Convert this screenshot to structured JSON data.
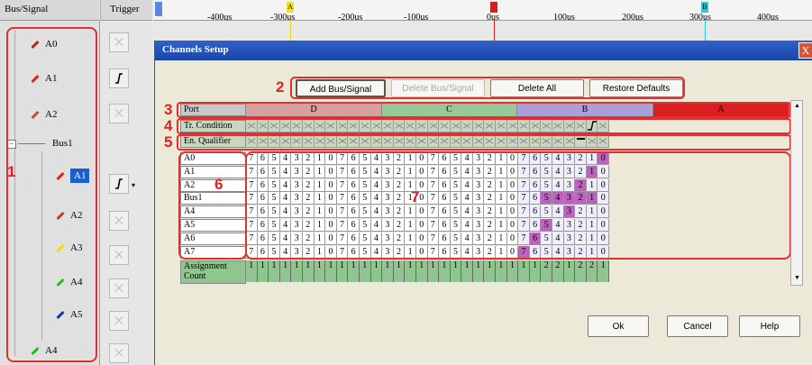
{
  "left_panel": {
    "header": "Bus/Signal",
    "trigger_header": "Trigger",
    "signals": [
      {
        "label": "A0",
        "color": "#b8202a",
        "trigger": "x"
      },
      {
        "label": "A1",
        "color": "#e02020",
        "trigger": "rise"
      },
      {
        "label": "A2",
        "color": "#d04818",
        "trigger": "x"
      },
      {
        "label": "Bus1",
        "color": "",
        "trigger": "none"
      },
      {
        "label": "A1",
        "color": "#e02020",
        "trigger": "rise"
      },
      {
        "label": "A2",
        "color": "#c04020",
        "trigger": "x"
      },
      {
        "label": "A3",
        "color": "#e8e000",
        "trigger": "x"
      },
      {
        "label": "A4",
        "color": "#20c020",
        "trigger": "x"
      },
      {
        "label": "A5",
        "color": "#1830c0",
        "trigger": "x"
      },
      {
        "label": "A4",
        "color": "#20c020",
        "trigger": "x"
      }
    ]
  },
  "timeline": {
    "ticks": [
      "-400us",
      "-300us",
      "-200us",
      "-100us",
      "0us",
      "100us",
      "200us",
      "300us",
      "400us"
    ],
    "markers": [
      {
        "label": "A",
        "color": "#f0e020"
      },
      {
        "label": "T",
        "color": "#d02020"
      },
      {
        "label": "B",
        "color": "#30c8d8"
      }
    ]
  },
  "dialog": {
    "title": "Channels Setup",
    "close_label": "X",
    "buttons": {
      "add": "Add Bus/Signal",
      "delete": "Delete Bus/Signal",
      "delete_all": "Delete All",
      "restore": "Restore Defaults",
      "ok": "Ok",
      "cancel": "Cancel",
      "help": "Help"
    },
    "rows": {
      "port": "Port",
      "tr_condition": "Tr. Condition",
      "en_qualifier": "En. Qualifier",
      "assignment": "Assignment Count"
    },
    "ports": [
      {
        "name": "D",
        "color": "#d4a0a0"
      },
      {
        "name": "C",
        "color": "#98c898"
      },
      {
        "name": "B",
        "color": "#a8a0d8"
      },
      {
        "name": "A",
        "color": "#d82020"
      }
    ],
    "bits": [
      "7",
      "6",
      "5",
      "4",
      "3",
      "2",
      "1",
      "0"
    ],
    "signal_rows": [
      "A0",
      "A1",
      "A2",
      "Bus1",
      "A4",
      "A5",
      "A6",
      "A7"
    ],
    "assignment_values": [
      "1",
      "1",
      "1",
      "1",
      "1",
      "1",
      "1",
      "1",
      "1",
      "1",
      "1",
      "1",
      "1",
      "1",
      "1",
      "1",
      "1",
      "1",
      "1",
      "1",
      "1",
      "1",
      "1",
      "1",
      "1",
      "1",
      "2",
      "2",
      "1",
      "2",
      "2",
      "1"
    ]
  },
  "annotations": [
    "1",
    "2",
    "3",
    "4",
    "5",
    "6",
    "7"
  ]
}
